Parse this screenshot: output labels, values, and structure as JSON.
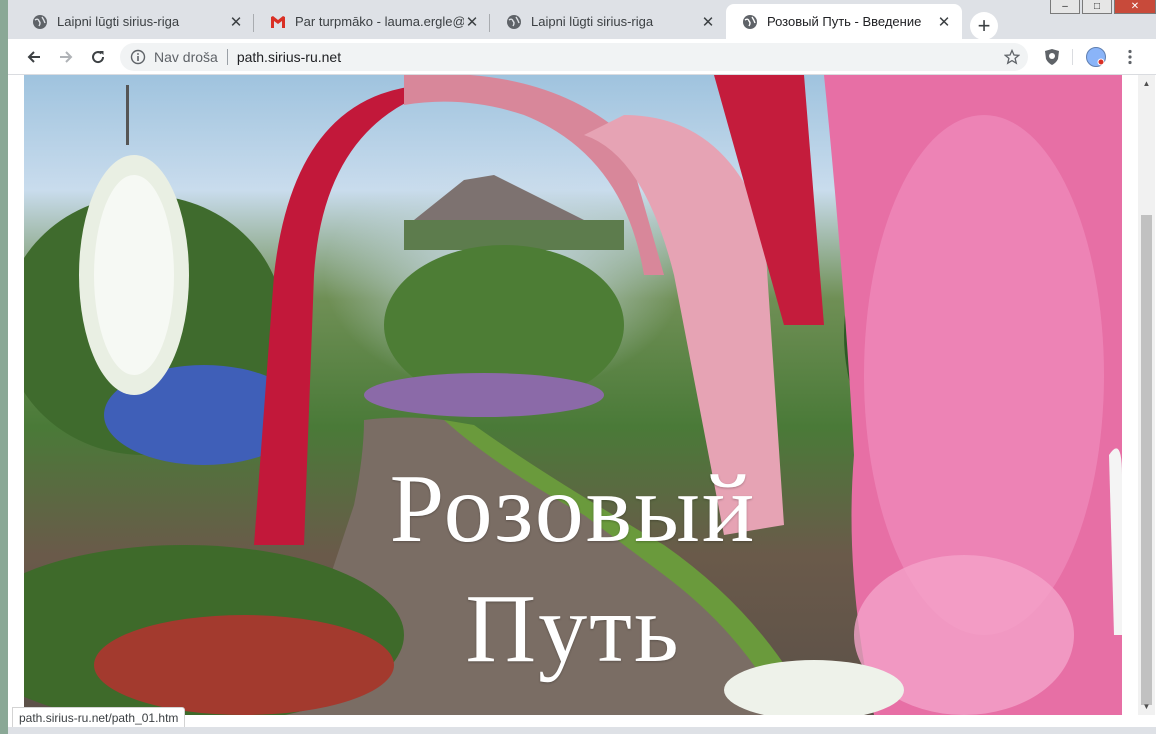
{
  "window": {
    "controls": [
      "–",
      "□",
      "✕"
    ]
  },
  "tabs": [
    {
      "title": "Laipni lūgti sirius-riga",
      "icon": "globe-icon",
      "active": false
    },
    {
      "title": "Par turpmāko - lauma.ergle@gm",
      "icon": "gmail-icon",
      "active": false
    },
    {
      "title": "Laipni lūgti sirius-riga",
      "icon": "globe-icon",
      "active": false
    },
    {
      "title": "Розовый Путь - Введение",
      "icon": "globe-icon",
      "active": true
    }
  ],
  "new_tab_label": "+",
  "tab_close_glyph": "✕",
  "address_bar": {
    "security_label": "Nav droša",
    "url": "path.sirius-ru.net"
  },
  "page": {
    "title_line1": "Розовый",
    "title_line2": "Путь"
  },
  "status_bar": {
    "link_url": "path.sirius-ru.net/path_01.htm"
  },
  "colors": {
    "tabstrip": "#dee1e6",
    "active_tab": "#ffffff",
    "omnibox": "#f1f3f4",
    "gmail_red": "#d93025"
  }
}
